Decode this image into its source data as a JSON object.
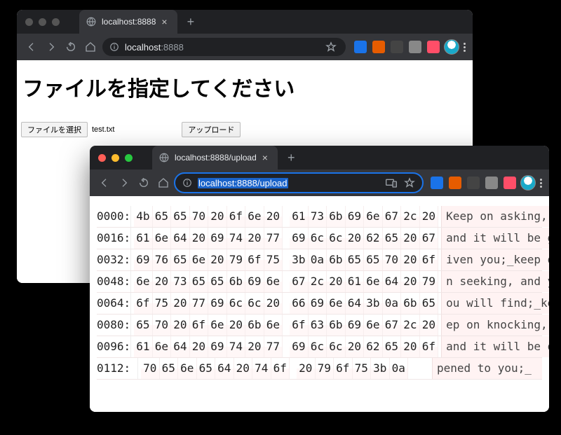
{
  "window1": {
    "tab_title": "localhost:8888",
    "url_host": "localhost",
    "url_port": ":8888",
    "page_heading": "ファイルを指定してください",
    "choose_label": "ファイルを選択",
    "chosen_file": "test.txt",
    "upload_label": "アップロード"
  },
  "window2": {
    "tab_title": "localhost:8888/upload",
    "url_full": "localhost:8888/upload",
    "hex_rows": [
      {
        "offset": "0000:",
        "bytes": [
          "4b",
          "65",
          "65",
          "70",
          "20",
          "6f",
          "6e",
          "20",
          "",
          "61",
          "73",
          "6b",
          "69",
          "6e",
          "67",
          "2c",
          "20"
        ],
        "ascii": "Keep on asking,"
      },
      {
        "offset": "0016:",
        "bytes": [
          "61",
          "6e",
          "64",
          "20",
          "69",
          "74",
          "20",
          "77",
          "",
          "69",
          "6c",
          "6c",
          "20",
          "62",
          "65",
          "20",
          "67"
        ],
        "ascii": "and it will be g"
      },
      {
        "offset": "0032:",
        "bytes": [
          "69",
          "76",
          "65",
          "6e",
          "20",
          "79",
          "6f",
          "75",
          "",
          "3b",
          "0a",
          "6b",
          "65",
          "65",
          "70",
          "20",
          "6f"
        ],
        "ascii": "iven you;_keep o"
      },
      {
        "offset": "0048:",
        "bytes": [
          "6e",
          "20",
          "73",
          "65",
          "65",
          "6b",
          "69",
          "6e",
          "",
          "67",
          "2c",
          "20",
          "61",
          "6e",
          "64",
          "20",
          "79"
        ],
        "ascii": "n seeking, and y"
      },
      {
        "offset": "0064:",
        "bytes": [
          "6f",
          "75",
          "20",
          "77",
          "69",
          "6c",
          "6c",
          "20",
          "",
          "66",
          "69",
          "6e",
          "64",
          "3b",
          "0a",
          "6b",
          "65"
        ],
        "ascii": "ou will find;_ke"
      },
      {
        "offset": "0080:",
        "bytes": [
          "65",
          "70",
          "20",
          "6f",
          "6e",
          "20",
          "6b",
          "6e",
          "",
          "6f",
          "63",
          "6b",
          "69",
          "6e",
          "67",
          "2c",
          "20"
        ],
        "ascii": "ep on knocking,"
      },
      {
        "offset": "0096:",
        "bytes": [
          "61",
          "6e",
          "64",
          "20",
          "69",
          "74",
          "20",
          "77",
          "",
          "69",
          "6c",
          "6c",
          "20",
          "62",
          "65",
          "20",
          "6f"
        ],
        "ascii": "and it will be o"
      },
      {
        "offset": "0112:",
        "bytes": [
          "70",
          "65",
          "6e",
          "65",
          "64",
          "20",
          "74",
          "6f",
          "",
          "20",
          "79",
          "6f",
          "75",
          "3b",
          "0a",
          "",
          "",
          ""
        ],
        "ascii": "pened to you;_"
      }
    ]
  }
}
